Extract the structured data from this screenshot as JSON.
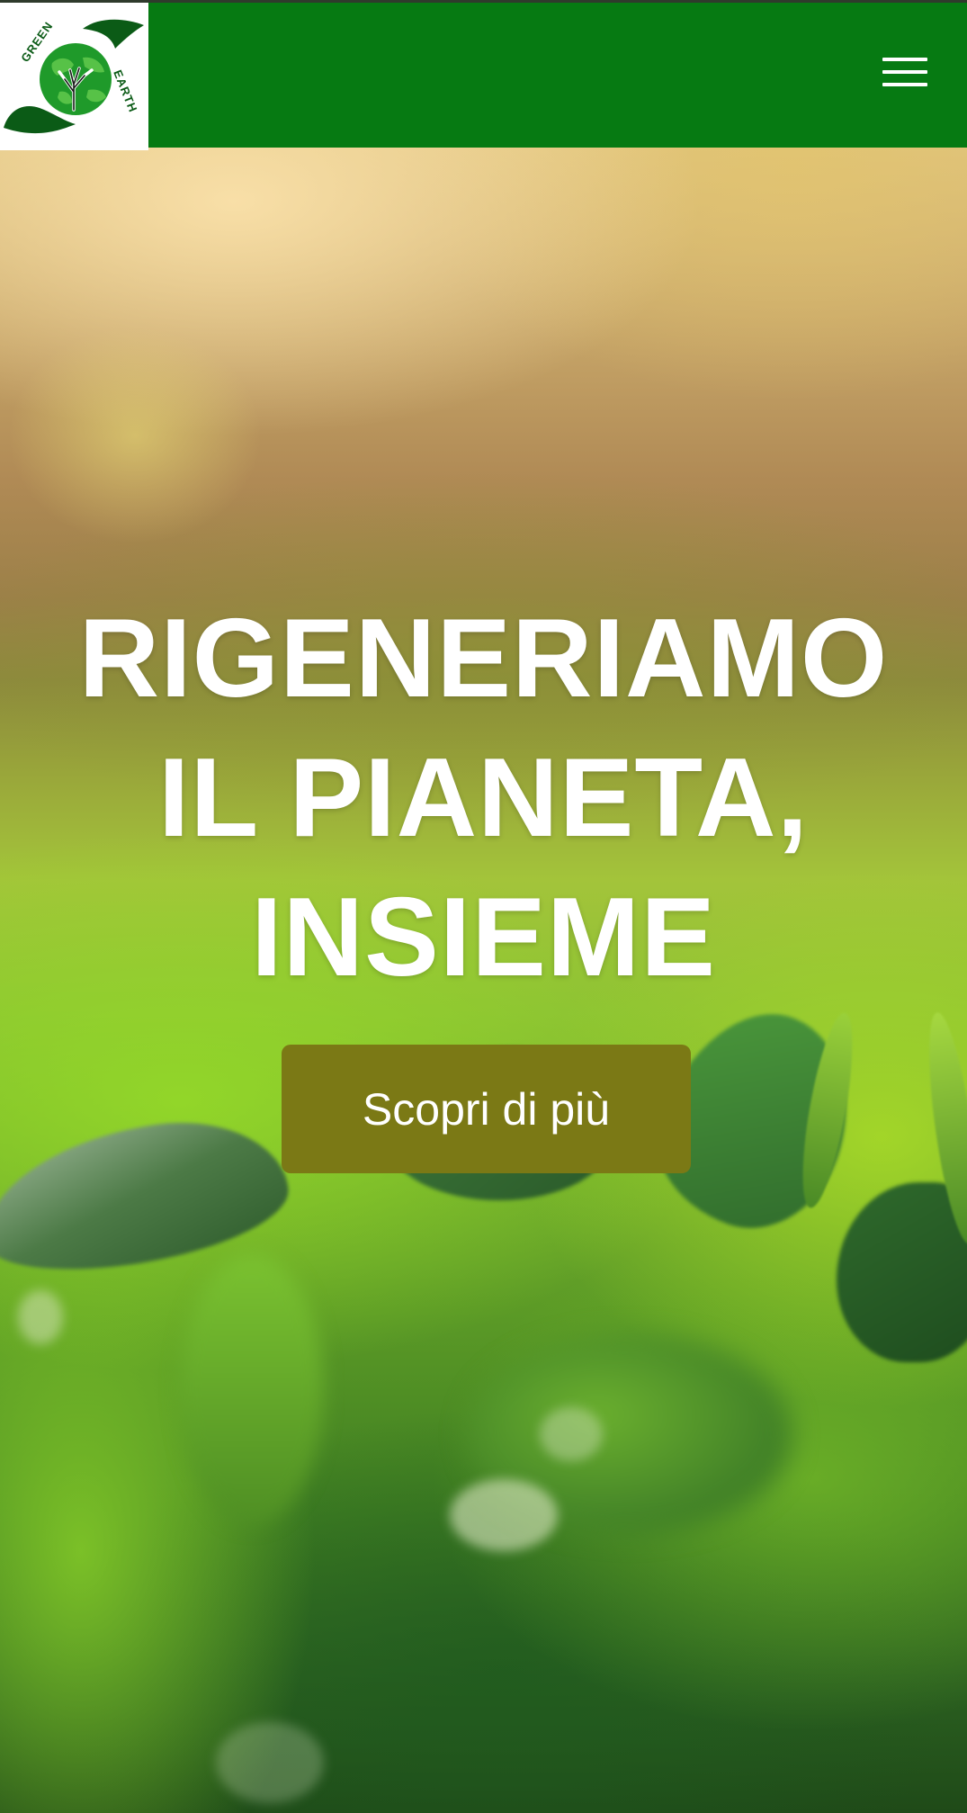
{
  "header": {
    "logo": {
      "text_top": "GREEN",
      "text_side": "EARTH",
      "icon": "globe-tree-hands-logo"
    },
    "menu_icon": "hamburger-menu-icon",
    "background_color": "#067a12"
  },
  "hero": {
    "title_lines": [
      "RIGENERIAMO",
      "IL PIANETA,",
      "INSIEME"
    ],
    "cta_label": "Scopri di più",
    "cta_color": "#7b7915"
  }
}
